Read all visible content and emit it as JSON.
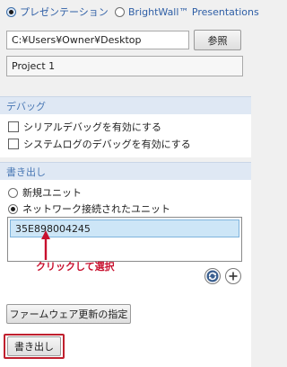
{
  "mode_tabs": [
    {
      "label": "プレゼンテーション",
      "selected": true
    },
    {
      "label": "BrightWall™ Presentations",
      "selected": false
    }
  ],
  "path": {
    "value": "C:¥Users¥Owner¥Desktop",
    "browse_label": "参照"
  },
  "project_name": "Project 1",
  "debug_section": {
    "title": "デバッグ",
    "options": [
      {
        "label": "シリアルデバッグを有効にする",
        "checked": false
      },
      {
        "label": "システムログのデバッグを有効にする",
        "checked": false
      }
    ]
  },
  "export_section": {
    "title": "書き出し",
    "options": [
      {
        "label": "新規ユニット",
        "selected": false
      },
      {
        "label": "ネットワーク接続されたユニット",
        "selected": true
      }
    ],
    "units": [
      "35E898004245"
    ],
    "annotation": "クリックして選択",
    "annotation_color": "#c8102e"
  },
  "firmware_button_label": "ファームウェア更新の指定",
  "write_button_label": "書き出し"
}
